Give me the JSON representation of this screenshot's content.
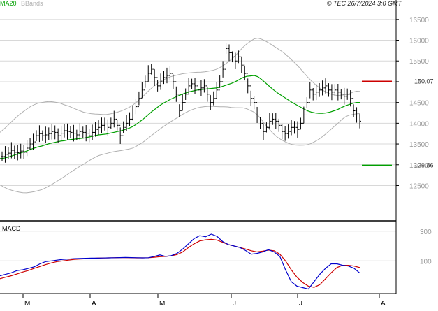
{
  "header": {
    "legend_ma": "MA20",
    "legend_bb": "BBands",
    "copyright": "© TEC 26/7/2024 3:0 GMT"
  },
  "colors": {
    "price_bars": "#000000",
    "ma20": "#00a000",
    "bbands": "#b0b0b0",
    "resistance": "#cc0000",
    "support": "#00a000",
    "macd": "#0000cc",
    "signal": "#cc0000",
    "grid": "#d8d8d8"
  },
  "chart_data": [
    {
      "type": "bar",
      "name": "price",
      "ylim": [
        11700,
        16800
      ],
      "yticks": [
        12500,
        13000,
        13500,
        14000,
        14500,
        15000,
        15500,
        16000,
        16500
      ],
      "ytick_labels": [
        "12500",
        "13000",
        "13500",
        "14000",
        "14500",
        "",
        "15500",
        "16000",
        "16500"
      ],
      "xticks": [
        "M",
        "A",
        "M",
        "J",
        "J",
        "A"
      ],
      "legend": [
        "MA20",
        "BBands"
      ],
      "levels": [
        {
          "label": "150.07",
          "value": 15007,
          "color": "#cc0000"
        },
        {
          "label": "129.86",
          "value": 12986,
          "color": "#00a000"
        }
      ],
      "series": [
        {
          "name": "price",
          "values": [
            13200,
            13250,
            13280,
            13350,
            13300,
            13290,
            13330,
            13300,
            13400,
            13500,
            13550,
            13700,
            13750,
            13700,
            13720,
            13750,
            13800,
            13780,
            13700,
            13760,
            13820,
            13800,
            13780,
            13760,
            13720,
            13800,
            13780,
            13760,
            13700,
            13780,
            13850,
            13900,
            13950,
            13980,
            13900,
            14000,
            14100,
            13950,
            13700,
            13900,
            14000,
            14100,
            14250,
            14400,
            14600,
            14800,
            15000,
            15200,
            15300,
            15100,
            14900,
            15000,
            15100,
            15150,
            15200,
            15000,
            14700,
            14300,
            14500,
            14700,
            14900,
            14950,
            14900,
            14800,
            14850,
            14900,
            14700,
            14500,
            14600,
            14800,
            15000,
            15300,
            15800,
            15700,
            15600,
            15500,
            15600,
            15400,
            15200,
            14900,
            14600,
            14500,
            14200,
            14000,
            13800,
            13900,
            14050,
            14100,
            14050,
            13950,
            13800,
            13750,
            13800,
            13900,
            13900,
            13850,
            14000,
            14200,
            14500,
            14800,
            14700,
            14750,
            14800,
            14850,
            14900,
            14800,
            14750,
            14800,
            14750,
            14700,
            14650,
            14700,
            14600,
            14300,
            14200,
            14050
          ]
        },
        {
          "name": "MA20",
          "values": [
            13150,
            13160,
            13180,
            13210,
            13240,
            13270,
            13300,
            13330,
            13370,
            13400,
            13430,
            13450,
            13480,
            13510,
            13530,
            13550,
            13570,
            13580,
            13600,
            13610,
            13620,
            13630,
            13640,
            13660,
            13680,
            13700,
            13720,
            13730,
            13740,
            13760,
            13780,
            13800,
            13820,
            13850,
            13880,
            13920,
            13980,
            14050,
            14120,
            14200,
            14280,
            14350,
            14420,
            14480,
            14530,
            14580,
            14620,
            14660,
            14700,
            14730,
            14760,
            14780,
            14800,
            14810,
            14820,
            14830,
            14840,
            14850,
            14870,
            14900,
            14930,
            14960,
            15000,
            15050,
            15100,
            15130,
            15140,
            15150,
            15120,
            15050,
            14970,
            14890,
            14810,
            14740,
            14680,
            14620,
            14560,
            14500,
            14450,
            14400,
            14350,
            14300,
            14270,
            14250,
            14240,
            14240,
            14250,
            14270,
            14300,
            14330,
            14380,
            14420,
            14450,
            14480,
            14500,
            14500
          ]
        }
      ]
    },
    {
      "type": "line",
      "name": "MACD",
      "ylim": [
        -120,
        360
      ],
      "yticks": [
        100,
        300
      ],
      "ytick_labels": [
        "100",
        "300"
      ],
      "legend": [
        "MACD"
      ],
      "series": [
        {
          "name": "MACD",
          "values": [
            0,
            10,
            20,
            35,
            40,
            50,
            60,
            80,
            95,
            100,
            105,
            110,
            112,
            115,
            116,
            117,
            118,
            118,
            119,
            120,
            121,
            122,
            123,
            122,
            121,
            120,
            121,
            130,
            140,
            130,
            135,
            150,
            180,
            215,
            250,
            270,
            262,
            280,
            265,
            230,
            210,
            200,
            190,
            170,
            145,
            150,
            160,
            175,
            160,
            130,
            40,
            -40,
            -70,
            -80,
            -90,
            -40,
            10,
            50,
            80,
            80,
            70,
            65,
            50,
            18
          ]
        },
        {
          "name": "signal",
          "values": [
            -20,
            -10,
            0,
            12,
            25,
            36,
            50,
            62,
            75,
            86,
            95,
            100,
            105,
            110,
            112,
            114,
            116,
            118,
            119,
            120,
            121,
            122,
            122,
            121,
            120,
            120,
            121,
            124,
            128,
            130,
            134,
            142,
            160,
            190,
            215,
            235,
            242,
            245,
            240,
            225,
            210,
            200,
            190,
            180,
            168,
            160,
            165,
            172,
            168,
            145,
            100,
            40,
            -10,
            -45,
            -70,
            -78,
            -60,
            -20,
            20,
            55,
            70,
            70,
            65,
            55
          ]
        }
      ]
    }
  ]
}
